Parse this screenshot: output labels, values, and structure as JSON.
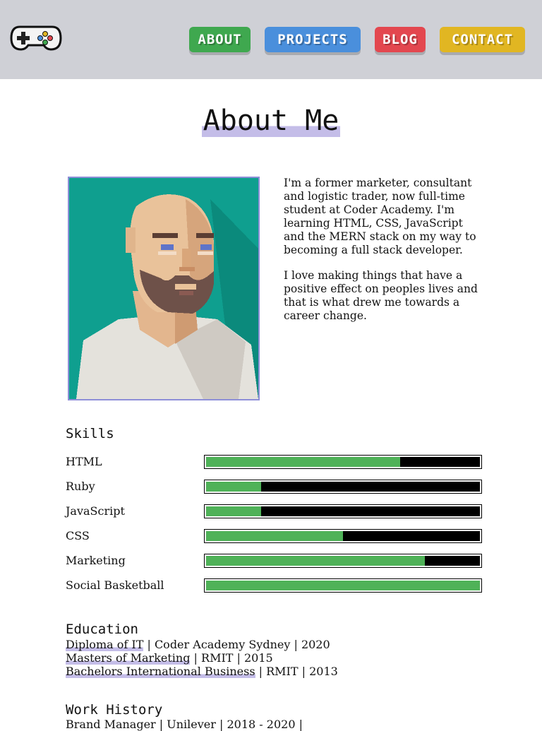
{
  "nav": {
    "about": "ABOUT",
    "projects": "PROJECTS",
    "blog": "BLOG",
    "contact": "CONTACT"
  },
  "logo": {
    "icon": "gamepad-icon"
  },
  "page_title": "About Me",
  "bio": {
    "p1": "I'm a former marketer, consultant and logistic trader, now full-time student at Coder Academy. I'm learning HTML, CSS, JavaScript and the MERN stack on my way to becoming a full stack developer.",
    "p2": "I love making things that have a positive effect on peoples lives and that is what drew me towards a career change."
  },
  "skills": {
    "heading": "Skills",
    "items": [
      {
        "name": "HTML",
        "level": 0.71
      },
      {
        "name": "Ruby",
        "level": 0.2
      },
      {
        "name": "JavaScript",
        "level": 0.2
      },
      {
        "name": "CSS",
        "level": 0.5
      },
      {
        "name": "Marketing",
        "level": 0.8
      },
      {
        "name": "Social Basketball",
        "level": 1.0
      }
    ]
  },
  "education": {
    "heading": "Education",
    "items": [
      {
        "degree": "Diploma of IT",
        "rest": " | Coder Academy Sydney | 2020"
      },
      {
        "degree": "Masters of Marketing",
        "rest": " | RMIT | 2015"
      },
      {
        "degree": "Bachelors International Business",
        "rest": " | RMIT | 2013"
      }
    ]
  },
  "work": {
    "heading": "Work History",
    "first_line": "Brand Manager | Unilever | 2018 - 2020 |"
  },
  "colors": {
    "header_bg": "#cfd0d6",
    "about": "#3fa84f",
    "projects": "#4a8fdc",
    "blog": "#e3474f",
    "contact": "#e1b622",
    "highlight": "#c4bde8",
    "skill_fill": "#4fb258"
  }
}
